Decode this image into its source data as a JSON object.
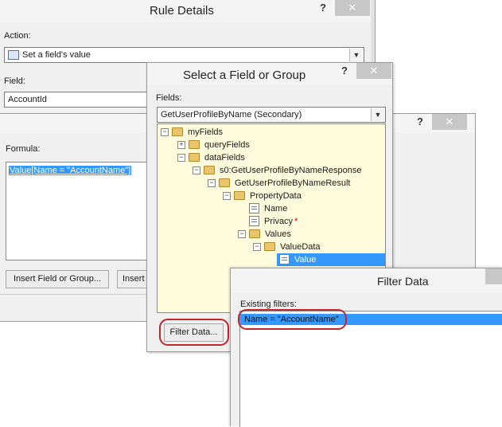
{
  "rule_details": {
    "title": "Rule Details",
    "help": "?",
    "close": "✕",
    "action_label": "Action:",
    "action_value": "Set a field's value",
    "field_label": "Field:",
    "field_value": "AccountId"
  },
  "formula_dialog": {
    "help": "?",
    "close": "✕",
    "formula_label": "Formula:",
    "formula_value": "Value[Name = \"AccountName\"]",
    "insert_field_button": "Insert Field or Group...",
    "insert_function_button": "Insert"
  },
  "select_field": {
    "title": "Select a Field or Group",
    "help": "?",
    "close": "✕",
    "fields_label": "Fields:",
    "data_source": "GetUserProfileByName (Secondary)",
    "tree": [
      {
        "label": "myFields"
      },
      {
        "label": "queryFields"
      },
      {
        "label": "dataFields"
      },
      {
        "label": "s0:GetUserProfileByNameResponse"
      },
      {
        "label": "GetUserProfileByNameResult"
      },
      {
        "label": "PropertyData"
      },
      {
        "label": "Name"
      },
      {
        "label": "Privacy",
        "required": "*"
      },
      {
        "label": "Values"
      },
      {
        "label": "ValueData"
      },
      {
        "label": "Value"
      }
    ],
    "filter_button": "Filter Data..."
  },
  "filter_data": {
    "title": "Filter Data",
    "existing_label": "Existing filters:",
    "filters": [
      "Name = \"AccountName\""
    ]
  },
  "colors": {
    "selection": "#3399ff",
    "tree_background": "#fefcdc",
    "highlight_oval": "#c0272d",
    "close_button": "#c7c7c7"
  }
}
